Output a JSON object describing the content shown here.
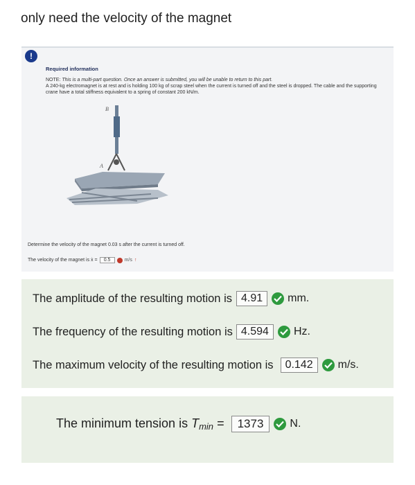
{
  "heading": "only need the velocity of the magnet",
  "problem": {
    "alert_symbol": "!",
    "title": "Required information",
    "note_label": "NOTE:",
    "note_italic": "This is a multi-part question. Once an answer is submitted, you will be unable to return to this part.",
    "description": "A 240-kg electromagnet is at rest and is holding 100 kg of scrap steel when the current is turned off and the steel is dropped. The cable and the supporting crane have a total stiffness equivalent to a spring of constant 200 kN/m.",
    "figure_labels": {
      "b": "B",
      "a": "A"
    },
    "question": "Determine the velocity of the magnet 0.03 s after the current is turned off.",
    "velocity_prefix": "The velocity of the magnet is ẋ =",
    "velocity_value": "0.5",
    "velocity_unit": "m/s",
    "velocity_arrow": "↑"
  },
  "results": {
    "amplitude_label": "The amplitude of the resulting motion is",
    "amplitude_value": "4.91",
    "amplitude_unit": "mm.",
    "frequency_label": "The frequency of the resulting motion is",
    "frequency_value": "4.594",
    "frequency_unit": "Hz.",
    "max_velocity_label": "The maximum velocity of the resulting motion is",
    "max_velocity_value": "0.142",
    "max_velocity_unit": "m/s."
  },
  "tension": {
    "label_prefix": "The minimum tension is",
    "label_symbol": "T",
    "label_sub": "min",
    "equals": "=",
    "value": "1373",
    "unit": "N."
  },
  "colors": {
    "correct_green": "#2e9a3e",
    "wrong_red": "#c0392b",
    "result_panel_bg": "#eaf0e6",
    "alert_blue": "#1a3a8c"
  }
}
